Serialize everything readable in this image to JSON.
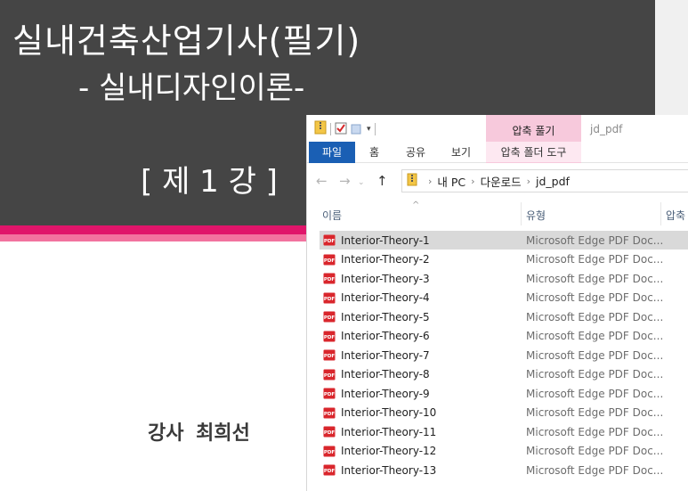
{
  "slide": {
    "title": "실내건축산업기사(필기)",
    "subtitle": "- 실내디자인이론-",
    "lesson": "[ 제 1 강 ]",
    "instructor": "강사  최희선",
    "colors": {
      "header": "#454545",
      "stripe_dark": "#e0156a",
      "stripe_light": "#f2739f"
    }
  },
  "explorer": {
    "window_title": "jd_pdf",
    "context_tab_group": "압축 풀기",
    "ribbon_tabs": {
      "file": "파일",
      "home": "홈",
      "share": "공유",
      "view": "보기",
      "context": "압축 폴더 도구"
    },
    "breadcrumb": [
      "내 PC",
      "다운로드",
      "jd_pdf"
    ],
    "columns": {
      "name": "이름",
      "type": "유형",
      "compressed": "압축"
    },
    "files": [
      {
        "name": "Interior-Theory-1",
        "type": "Microsoft Edge PDF Doc...",
        "selected": true
      },
      {
        "name": "Interior-Theory-2",
        "type": "Microsoft Edge PDF Doc..."
      },
      {
        "name": "Interior-Theory-3",
        "type": "Microsoft Edge PDF Doc..."
      },
      {
        "name": "Interior-Theory-4",
        "type": "Microsoft Edge PDF Doc..."
      },
      {
        "name": "Interior-Theory-5",
        "type": "Microsoft Edge PDF Doc..."
      },
      {
        "name": "Interior-Theory-6",
        "type": "Microsoft Edge PDF Doc..."
      },
      {
        "name": "Interior-Theory-7",
        "type": "Microsoft Edge PDF Doc..."
      },
      {
        "name": "Interior-Theory-8",
        "type": "Microsoft Edge PDF Doc..."
      },
      {
        "name": "Interior-Theory-9",
        "type": "Microsoft Edge PDF Doc..."
      },
      {
        "name": "Interior-Theory-10",
        "type": "Microsoft Edge PDF Doc..."
      },
      {
        "name": "Interior-Theory-11",
        "type": "Microsoft Edge PDF Doc..."
      },
      {
        "name": "Interior-Theory-12",
        "type": "Microsoft Edge PDF Doc..."
      },
      {
        "name": "Interior-Theory-13",
        "type": "Microsoft Edge PDF Doc..."
      }
    ],
    "colors": {
      "file_tab": "#1a5fb4",
      "context_tab": "#f7c9dc",
      "selected_row": "#d9d9d9"
    },
    "icons": {
      "quick_access": [
        "zip-folder-icon",
        "properties-check-icon",
        "new-folder-icon"
      ],
      "file": "pdf-file-icon"
    }
  }
}
